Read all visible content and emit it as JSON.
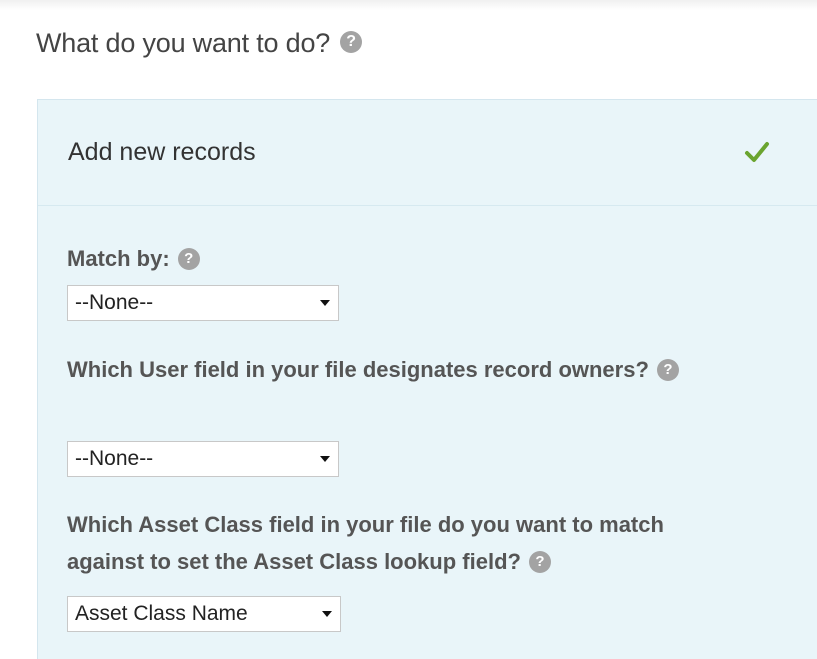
{
  "heading": "What do you want to do?",
  "help_glyph": "?",
  "panel": {
    "selected_option": "Add new records",
    "check_icon": "checkmark-icon",
    "check_color": "#6aa42f",
    "background_color": "#e9f5f9"
  },
  "fields": {
    "match_by": {
      "label": "Match by:",
      "value": "--None--"
    },
    "owner_field": {
      "label": "Which User field in your file designates record owners?",
      "value": "--None--"
    },
    "asset_class_field": {
      "label": "Which Asset Class field in your file do you want to match against to set the Asset Class lookup field?",
      "value": "Asset Class Name"
    }
  }
}
